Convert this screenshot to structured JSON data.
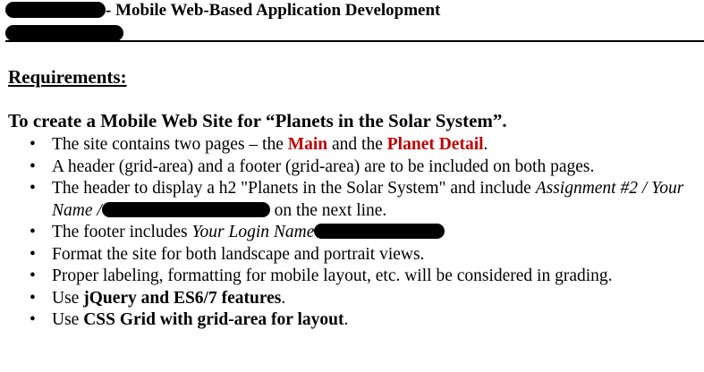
{
  "header": {
    "title": "- Mobile Web-Based Application Development"
  },
  "requirements": {
    "heading": "Requirements:",
    "task": "To create a Mobile Web Site for “Planets in the Solar System”.",
    "items": [
      {
        "p1": "The site contains two pages – the ",
        "main": "Main",
        "p2": " and the ",
        "detail": "Planet Detail",
        "p3": "."
      },
      {
        "text": "A header (grid-area) and a footer (grid-area) are to be included on both pages."
      },
      {
        "p1": "The header to display a h2 \"Planets in the Solar System\" and include ",
        "italic1": "Assignment #2 / Your Name /",
        "p2": " on the next line."
      },
      {
        "p1": "The footer includes ",
        "italic1": "Your Login Name"
      },
      {
        "text": "Format the site for both landscape and portrait views."
      },
      {
        "text": "Proper labeling, formatting for mobile layout, etc. will be considered in grading."
      },
      {
        "p1": "Use ",
        "bold1": "jQuery and ES6/7 features",
        "p2": "."
      },
      {
        "p1": "Use ",
        "bold1": "CSS Grid with grid-area for layout",
        "p2": "."
      }
    ]
  }
}
